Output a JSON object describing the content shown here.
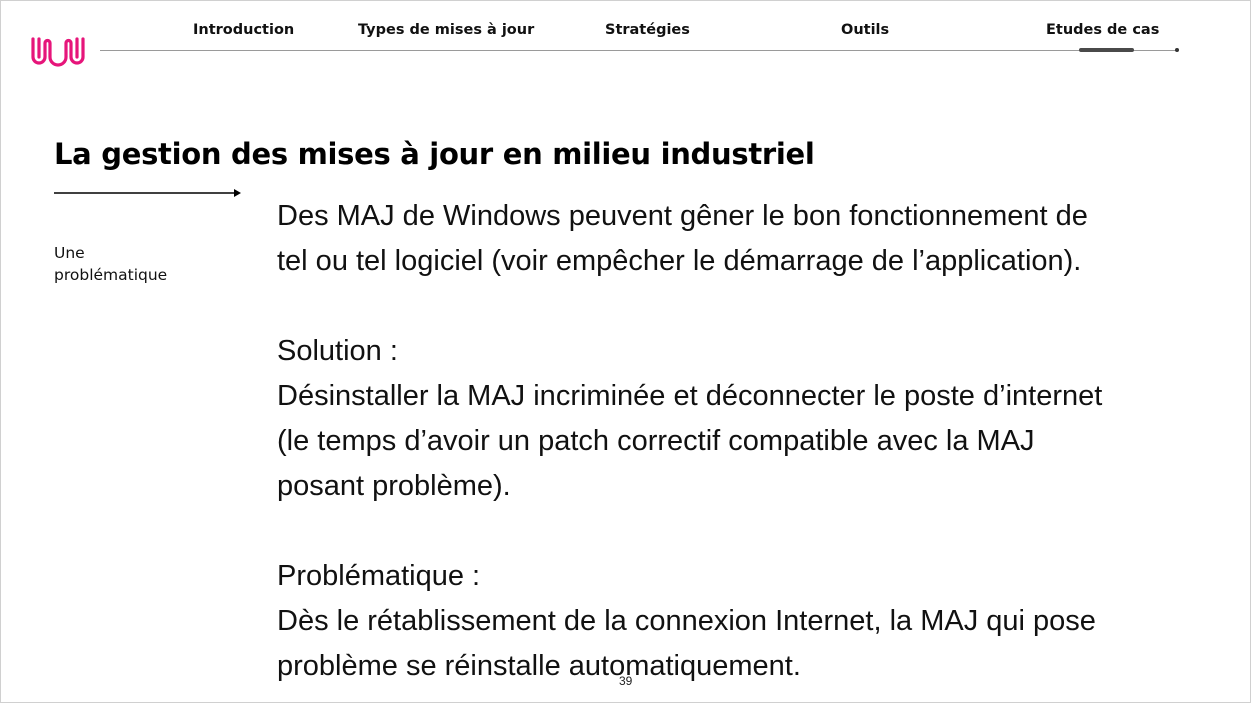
{
  "colors": {
    "logo": "#e6157a",
    "nav_line": "#9a9a9a",
    "active_indicator": "#4a4a4a",
    "text": "#111111"
  },
  "logo": {
    "icon": "wavy-u-brand-logo"
  },
  "nav": {
    "items": [
      {
        "label": "Introduction"
      },
      {
        "label": "Types de mises à jour"
      },
      {
        "label": "Stratégies"
      },
      {
        "label": "Outils"
      },
      {
        "label": "Etudes de cas"
      }
    ],
    "active_label": "Etudes de cas"
  },
  "slide": {
    "title": "La gestion des mises à jour en milieu industriel",
    "side_label": {
      "line1": "Une",
      "line2": "problématique"
    },
    "paragraphs": {
      "intro": {
        "line1": "Des MAJ de Windows peuvent gêner le bon fonctionnement de",
        "line2": "tel ou tel logiciel (voir empêcher le démarrage de l’application)."
      },
      "solution": {
        "heading": "Solution :",
        "line1": "Désinstaller la MAJ incriminée et déconnecter le poste d’internet",
        "line2": "(le temps d’avoir un patch correctif compatible avec la MAJ",
        "line3": "posant problème)."
      },
      "problem": {
        "heading": "Problématique :",
        "line1": "Dès le rétablissement de la connexion Internet, la MAJ qui pose",
        "line2": "problème se réinstalle automatiquement."
      }
    },
    "page_number": "39"
  }
}
